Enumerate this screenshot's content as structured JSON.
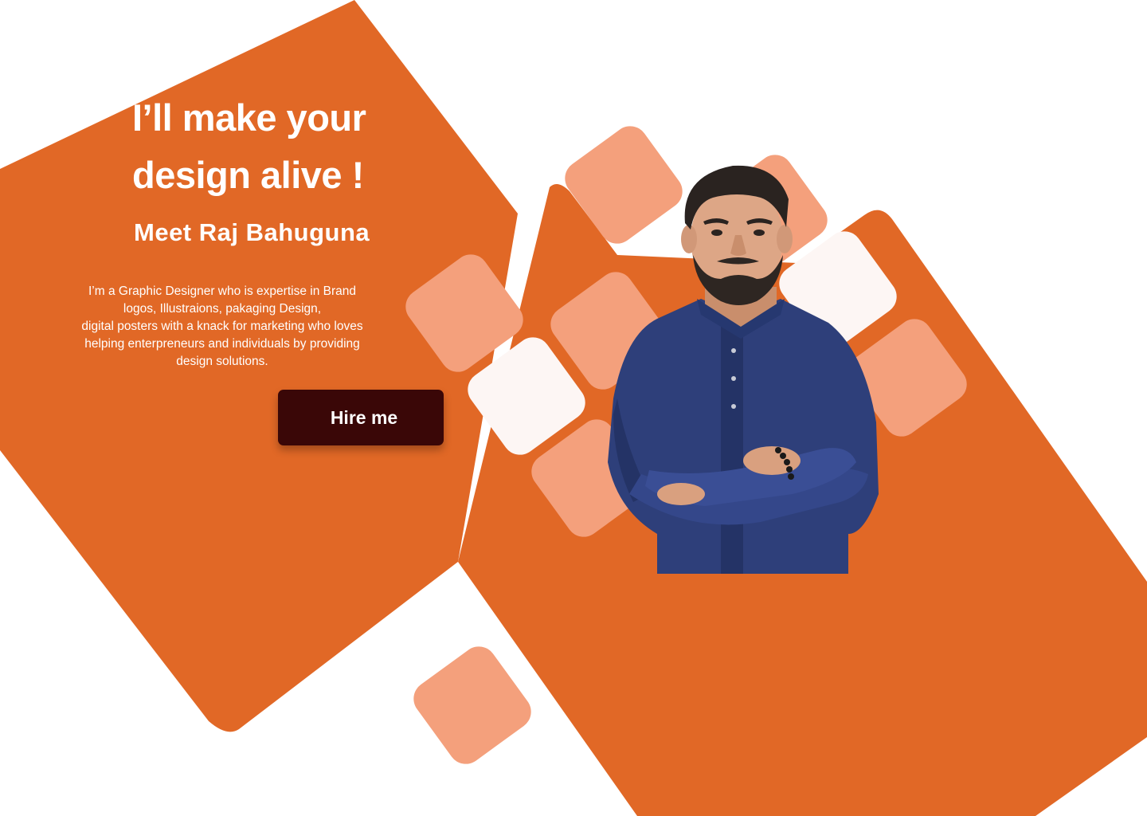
{
  "hero": {
    "title_line1": "I’ll make your",
    "title_line2": "design alive !",
    "subtitle": "Meet Raj Bahuguna",
    "description_lines": [
      "I’m a Graphic Designer who is expertise in Brand",
      "logos, Illustraions, pakaging Design,",
      "digital posters with a knack for marketing who loves",
      "helping enterpreneurs and individuals by providing",
      "design solutions."
    ],
    "cta_label": "Hire me"
  },
  "colors": {
    "primary_orange": "#E16826",
    "light_orange": "#F4A07C",
    "off_white": "#FDF6F4",
    "button_bg": "#3A0707",
    "text": "#FFFFFF"
  },
  "portrait": {
    "subject": "Raj Bahuguna",
    "image_icon": "person-portrait-icon"
  }
}
